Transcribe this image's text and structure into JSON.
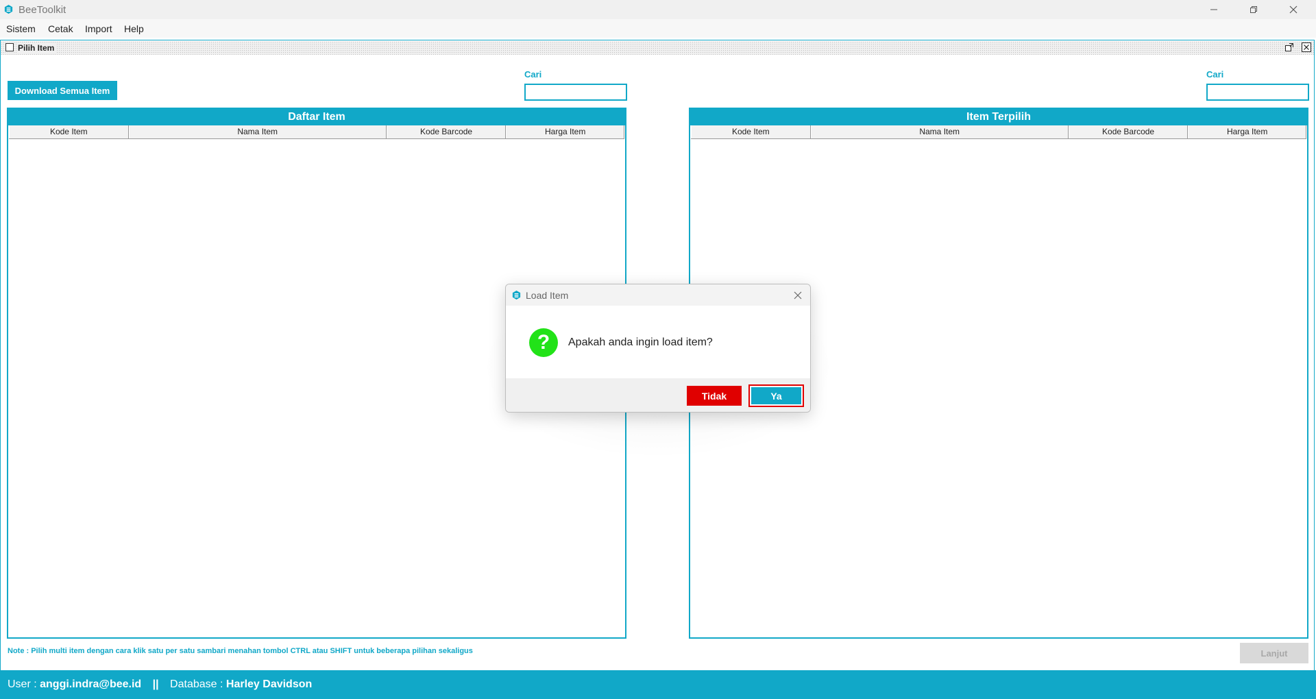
{
  "app": {
    "title": "BeeToolkit",
    "icon": "bee-logo-icon"
  },
  "window_controls": {
    "minimize_icon": "minimize-icon",
    "restore_icon": "restore-icon",
    "close_icon": "close-icon"
  },
  "menu": [
    "Sistem",
    "Cetak",
    "Import",
    "Help"
  ],
  "inner_window": {
    "title": "Pilih Item"
  },
  "toolbar": {
    "download_label": "Download Semua Item"
  },
  "search_left": {
    "label": "Cari",
    "value": ""
  },
  "search_right": {
    "label": "Cari",
    "value": ""
  },
  "left_panel": {
    "title": "Daftar Item",
    "columns": [
      "Kode Item",
      "Nama Item",
      "Kode Barcode",
      "Harga Item"
    ],
    "rows": []
  },
  "right_panel": {
    "title": "Item Terpilih",
    "columns": [
      "Kode Item",
      "Nama Item",
      "Kode Barcode",
      "Harga Item"
    ],
    "rows": []
  },
  "note": "Note : Pilih multi item dengan cara klik satu per satu sambari menahan tombol CTRL atau SHIFT untuk beberapa pilihan sekaligus",
  "lanjut_label": "Lanjut",
  "status": {
    "user_label": "User :",
    "user": "anggi.indra@bee.id",
    "separator": "||",
    "db_label": "Database :",
    "db": "Harley Davidson"
  },
  "dialog": {
    "title": "Load Item",
    "message": "Apakah anda ingin load item?",
    "icon": "question-icon",
    "icon_glyph": "?",
    "no_label": "Tidak",
    "yes_label": "Ya"
  },
  "colors": {
    "accent": "#11a8c8",
    "danger": "#e00000",
    "question": "#22e218"
  }
}
